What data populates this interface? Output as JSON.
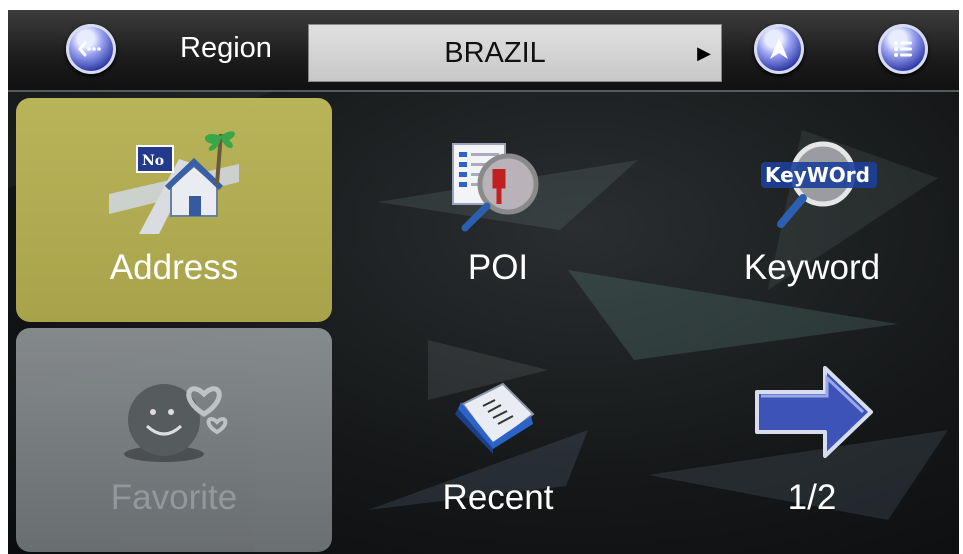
{
  "topbar": {
    "back_icon": "back-dots-icon",
    "region_label": "Region",
    "region_value": "BRAZIL",
    "region_arrow": "▶",
    "navigate_icon": "navigation-arrow-icon",
    "menu_icon": "list-menu-icon"
  },
  "tiles": [
    {
      "label": "Address",
      "icon": "address-house-icon",
      "state": "selected"
    },
    {
      "label": "POI",
      "icon": "poi-magnifier-icon",
      "state": "normal"
    },
    {
      "label": "Keyword",
      "icon": "keyword-magnifier-icon",
      "state": "normal"
    },
    {
      "label": "Favorite",
      "icon": "favorite-smiley-heart-icon",
      "state": "disabled"
    },
    {
      "label": "Recent",
      "icon": "recent-folder-icon",
      "state": "normal"
    },
    {
      "label": "1/2",
      "icon": "next-page-arrow-icon",
      "state": "normal"
    }
  ],
  "colors": {
    "selected_tile": "#b2ad52",
    "disabled_tile": "#7e8385",
    "button_blue": "#2f3aa8"
  },
  "icon_text": {
    "address_sign": "No",
    "keyword_logo": "KeyWOrd"
  }
}
